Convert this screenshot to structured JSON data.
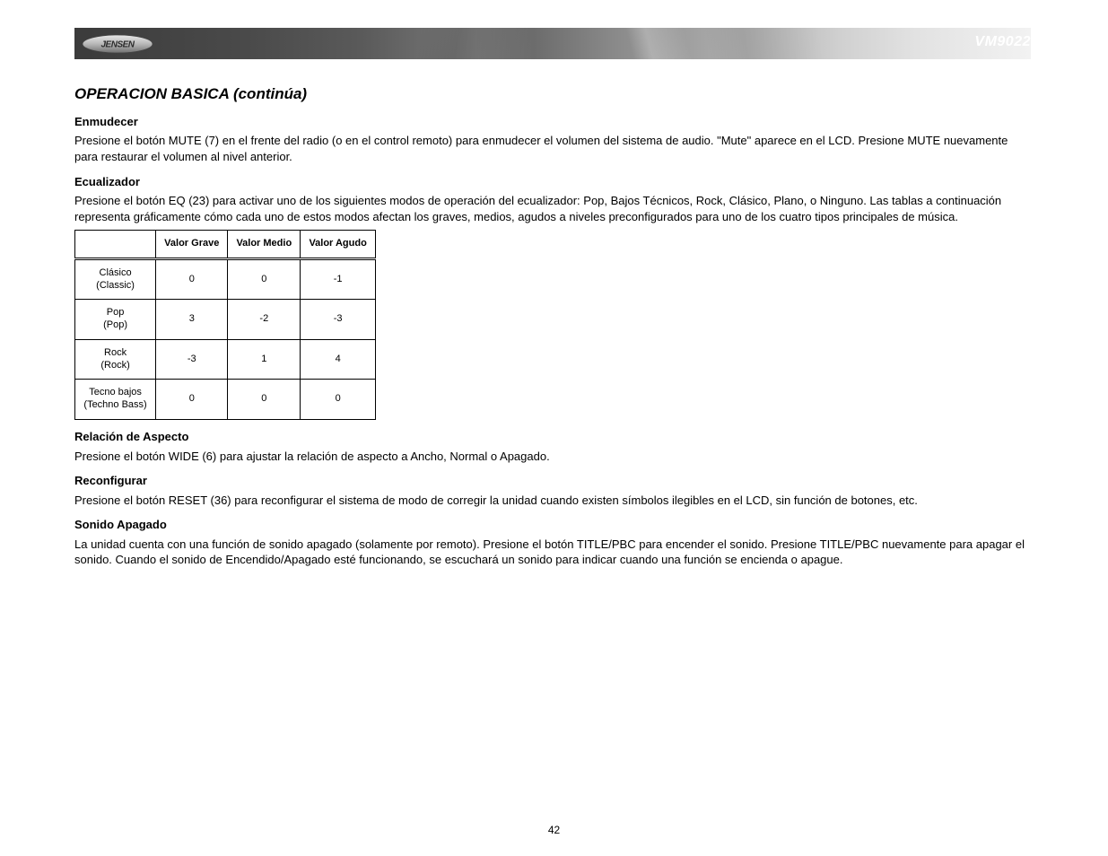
{
  "header": {
    "brand": "JENSEN",
    "model": "VM9022"
  },
  "section": {
    "title": "OPERACION BASICA (continúa)",
    "mute_title": "Enmudecer",
    "mute_text": "Presione el botón MUTE (7) en el frente del radio (o en el control remoto) para enmudecer el volumen del sistema de audio. \"Mute\" aparece en el LCD. Presione MUTE nuevamente para restaurar el volumen al nivel anterior.",
    "eq_title": "Ecualizador",
    "eq_text": "Presione el botón EQ (23) para activar uno de los siguientes modos de operación del ecualizador: Pop, Bajos Técnicos, Rock, Clásico, Plano, o Ninguno. Las tablas a continuación representa gráficamente cómo cada uno de estos modos afectan los graves, medios, agudos a niveles preconfigurados para uno de los cuatro tipos principales de música.",
    "aspect_title": "Relación de Aspecto",
    "aspect_text": "Presione el botón WIDE (6) para ajustar la relación de aspecto a Ancho, Normal o Apagado.",
    "reset_title": "Reconfigurar",
    "reset_text": "Presione el botón RESET (36) para reconfigurar el sistema de modo de corregir la unidad cuando existen símbolos ilegibles en el LCD, sin función de botones, etc.",
    "sound_off_title": "Sonido Apagado",
    "sound_off_text": "La unidad cuenta con una función de sonido apagado (solamente por remoto). Presione el botón TITLE/PBC para encender el sonido. Presione TITLE/PBC nuevamente para apagar el sonido. Cuando el sonido de Encendido/Apagado esté funcionando, se escuchará un sonido para indicar cuando una función se encienda o apague."
  },
  "eq_table": {
    "headers": [
      "",
      "Valor Grave",
      "Valor Medio",
      "Valor Agudo"
    ],
    "rows": [
      {
        "label": "Clásico",
        "sub": "(Classic)",
        "bass": "0",
        "mid": "0",
        "treble": "-1"
      },
      {
        "label": "Pop",
        "sub": "(Pop)",
        "bass": "3",
        "mid": "-2",
        "treble": "-3"
      },
      {
        "label": "Rock",
        "sub": "(Rock)",
        "bass": "-3",
        "mid": "1",
        "treble": "4"
      },
      {
        "label": "Tecno bajos",
        "sub": "(Techno Bass)",
        "bass": "0",
        "mid": "0",
        "treble": "0"
      }
    ]
  },
  "page_number": "42"
}
